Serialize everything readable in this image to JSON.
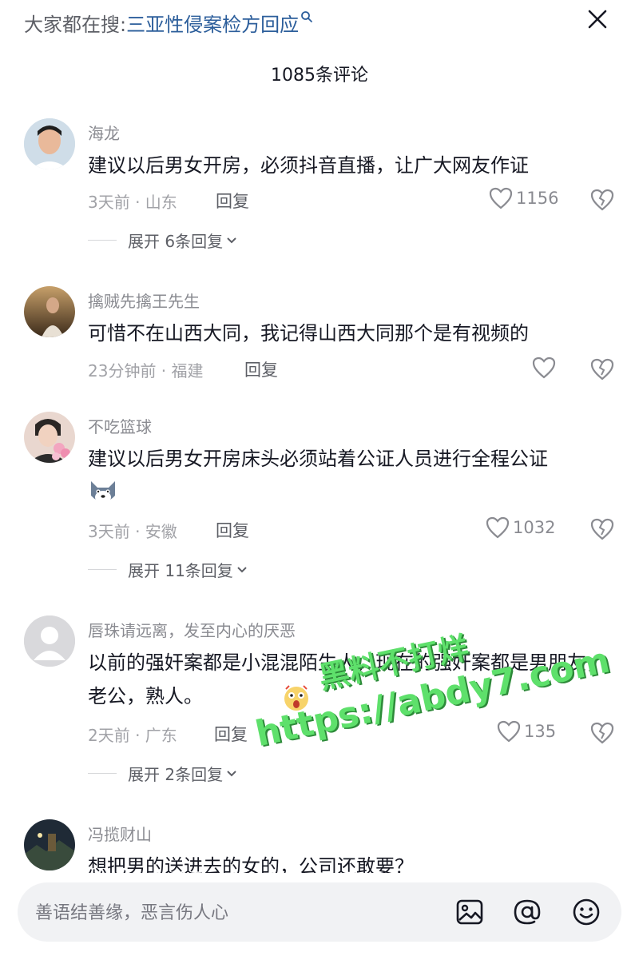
{
  "search": {
    "prefix": "大家都在搜:",
    "query": "三亚性侵案检方回应"
  },
  "header": {
    "count_label": "1085条评论"
  },
  "comments": [
    {
      "user": "海龙",
      "text": "建议以后男女开房，必须抖音直播，让广大网友作证",
      "meta": "3天前 · 山东",
      "reply": "回复",
      "likes": "1156",
      "expand": "展开 6条回复",
      "avatar_icon": "man-portrait-avatar"
    },
    {
      "user": "擒贼先擒王先生",
      "text": "可惜不在山西大同，我记得山西大同那个是有视频的",
      "meta": "23分钟前 · 福建",
      "reply": "回复",
      "likes": "",
      "avatar_icon": "sunset-portrait-avatar"
    },
    {
      "user": "不吃篮球",
      "text": "建议以后男女开房床头必须站着公证人员进行全程公证",
      "meta": "3天前 · 安徽",
      "reply": "回复",
      "likes": "1032",
      "expand": "展开 11条回复",
      "emoji": "dog-face-emoji",
      "avatar_icon": "flower-portrait-avatar"
    },
    {
      "user": "唇珠请远离，发至内心的厌恶",
      "text": "以前的强奸案都是小混混陌生人，现在的强奸案都是男朋友，老公，熟人。",
      "meta": "2天前 · 广东",
      "reply": "回复",
      "likes": "135",
      "expand": "展开 2条回复",
      "emoji": "shocked-face-emoji",
      "avatar_icon": "default-user-avatar"
    },
    {
      "user": "冯揽财山",
      "text": "想把男的送进去的女的，公司还敢要？",
      "avatar_icon": "night-scene-avatar"
    }
  ],
  "bottom": {
    "placeholder": "善语结善缘，恶言伤人心",
    "icons": [
      "image-icon",
      "at-icon",
      "emoji-icon"
    ]
  },
  "watermark": {
    "line1": "黑料不打烊",
    "line2": "https://abdy7.com"
  },
  "colors": {
    "link_blue": "#2c5e9b",
    "watermark_green": "#5ee06b",
    "text_dark": "#161823",
    "text_gray": "#8a8b91"
  }
}
